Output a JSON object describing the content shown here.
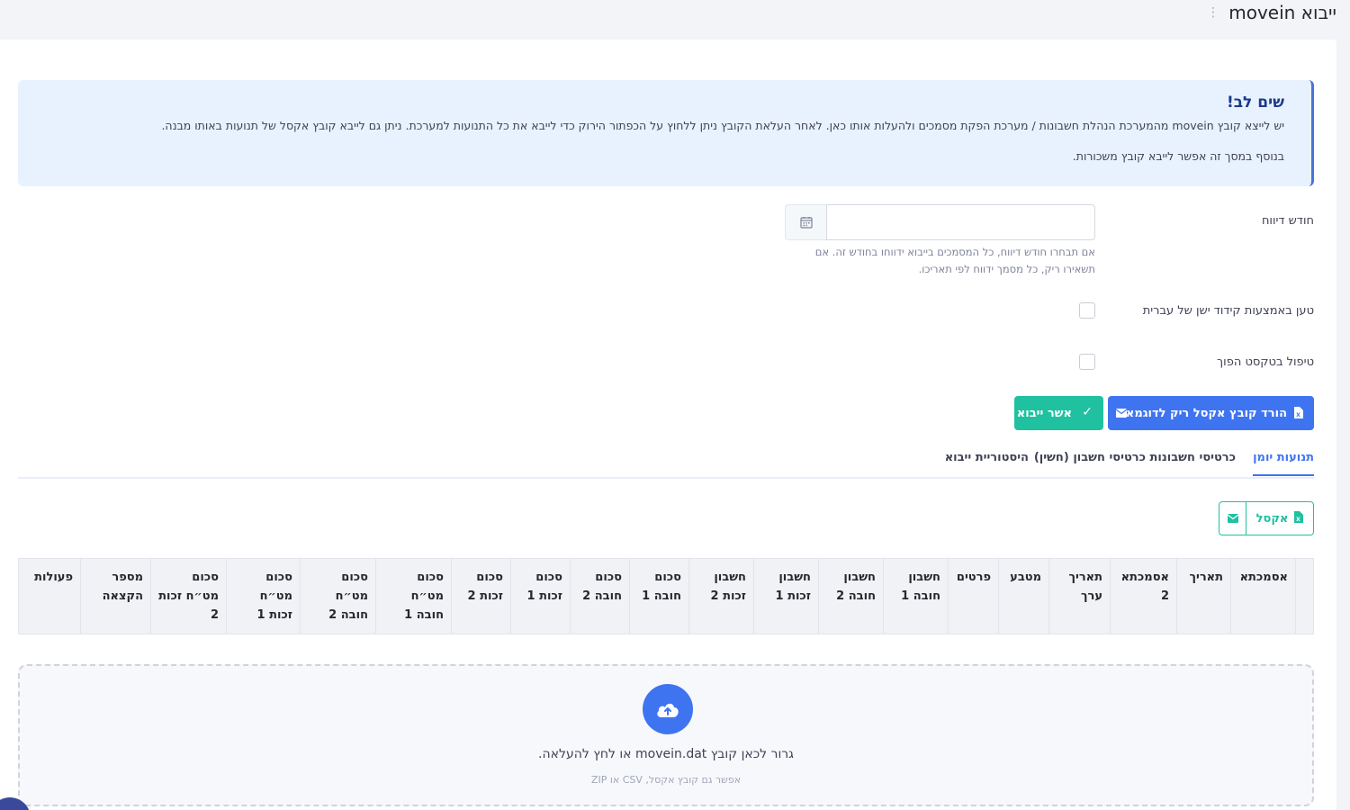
{
  "page": {
    "title": "ייבוא movein"
  },
  "alert": {
    "title": "שים לב!",
    "line1": "יש לייצא קובץ movein מהמערכת הנהלת חשבונות / מערכת הפקת מסמכים ולהעלות אותו כאן. לאחר העלאת הקובץ ניתן ללחוץ על הכפתור הירוק כדי לייבא את כל התנועות למערכת. ניתן גם לייבא קובץ אקסל של תנועות באותו מבנה.",
    "line2": "בנוסף במסך זה אפשר לייבא קובץ משכורות."
  },
  "form": {
    "report_month_label": "חודש דיווח",
    "report_month_value": "",
    "report_month_help": "אם תבחרו חודש דיווח, כל המסמכים בייבוא ידווחו בחודש זה. אם תשאירו ריק, כל מסמך ידווח לפי תאריכו.",
    "legacy_encoding_label": "טען באמצעות קידוד ישן של עברית",
    "reversed_text_label": "טיפול בטקסט הפוך"
  },
  "buttons": {
    "download_sample": "הורד קובץ אקסל ריק לדוגמא",
    "confirm_import": "אשר ייבוא",
    "excel": "אקסל"
  },
  "tabs": [
    {
      "label": "תנועות יומן",
      "active": true
    },
    {
      "label": "כרטיסי חשבונות",
      "active": false
    },
    {
      "label": "כרטיסי חשבון (חשין)",
      "active": false
    },
    {
      "label": "היסטוריית ייבוא",
      "active": false
    }
  ],
  "table": {
    "headers": [
      "",
      "אסמכתא",
      "תאריך",
      "אסמכתא 2",
      "תאריך ערך",
      "מטבע",
      "פרטים",
      "חשבון חובה 1",
      "חשבון חובה 2",
      "חשבון זכות 1",
      "חשבון זכות 2",
      "סכום חובה 1",
      "סכום חובה 2",
      "סכום זכות 1",
      "סכום זכות 2",
      "סכום מט״ח חובה 1",
      "סכום מט״ח חובה 2",
      "סכום מט״ח זכות 1",
      "סכום מט״ח זכות 2",
      "מספר הקצאה",
      "פעולות"
    ]
  },
  "dropzone": {
    "main_text": "גרור לכאן קובץ movein.dat או לחץ להעלאה.",
    "sub_text": "אפשר גם קובץ אקסל, CSV או ZIP"
  },
  "colors": {
    "primary": "#3f74f1",
    "success": "#1fc1a0",
    "alert_bg": "#e8f2fe"
  }
}
